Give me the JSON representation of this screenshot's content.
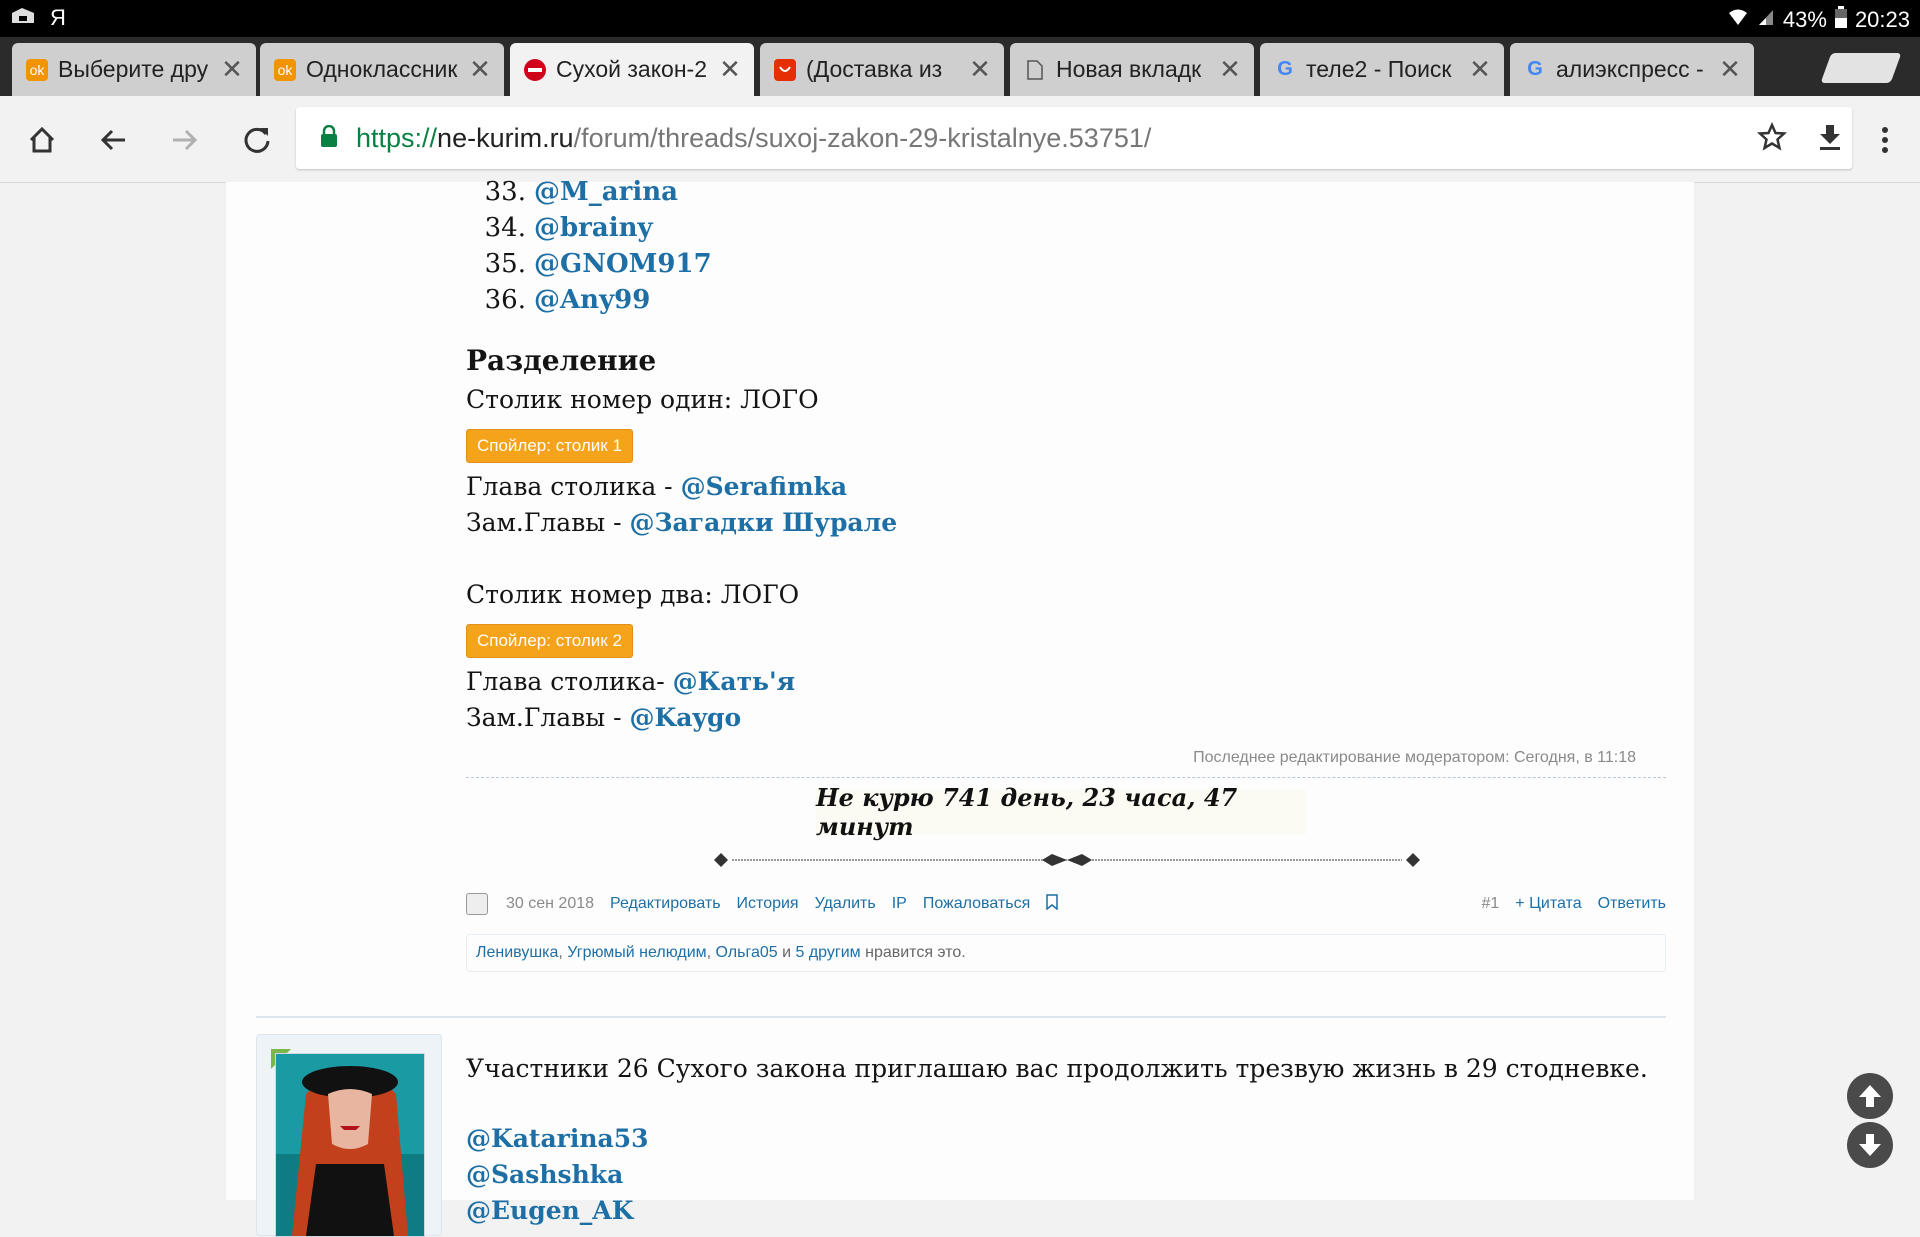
{
  "statusbar": {
    "left_icon_1": "briefcase-icon",
    "left_text": "Я",
    "battery": "43%",
    "time": "20:23"
  },
  "tabs": [
    {
      "title": "Выберите дру",
      "favicon": "ok-icon",
      "color": "#f29300"
    },
    {
      "title": "Одноклассник",
      "favicon": "ok-icon",
      "color": "#f29300"
    },
    {
      "title": "Сухой закон-2",
      "favicon": "no-entry-icon",
      "color": "#d0021b"
    },
    {
      "title": "(Доставка из",
      "favicon": "aliexpress-icon",
      "color": "#e62e04"
    },
    {
      "title": "Новая вкладк",
      "favicon": "page-icon",
      "color": "#777777"
    },
    {
      "title": "теле2 - Поиск",
      "favicon": "google-icon",
      "color": "#4285f4"
    },
    {
      "title": "алиэкспресс -",
      "favicon": "google-icon",
      "color": "#4285f4"
    }
  ],
  "tab_close_glyph": "✕",
  "toolbar": {
    "url_scheme": "https://",
    "url_host": "ne-kurim.ru",
    "url_path": "/forum/threads/suxoj-zakon-29-kristalnye.53751/"
  },
  "post1": {
    "members": [
      {
        "num": "33.",
        "name": "@M_arina"
      },
      {
        "num": "34.",
        "name": "@brainy"
      },
      {
        "num": "35.",
        "name": "@GNOM917"
      },
      {
        "num": "36.",
        "name": "@Any99"
      }
    ],
    "heading": "Разделение",
    "table1_text": "Столик номер один: ЛОГО",
    "spoiler1": "Спойлер: столик 1",
    "table1_head_prefix": "Глава столика - ",
    "table1_head_name": "@Serafimka",
    "table1_deputy_prefix": "Зам.Главы - ",
    "table1_deputy_name": "@Загадки Шурале",
    "table2_text": "Столик номер два: ЛОГО",
    "spoiler2": "Спойлер: столик 2",
    "table2_head_prefix": "Глава столика- ",
    "table2_head_name": "@Кать'я",
    "table2_deputy_prefix": "Зам.Главы - ",
    "table2_deputy_name": "@Kaygo",
    "edit_note": "Последнее редактирование модератором: Сегодня, в 11:18",
    "signature": "Не курю 741 день, 23 часа, 47 минут",
    "date": "30 сен 2018",
    "actions": [
      "Редактировать",
      "История",
      "Удалить",
      "IP",
      "Пожаловаться"
    ],
    "post_number": "#1",
    "quote": "+ Цитата",
    "reply": "Ответить",
    "likes_users": [
      "Ленивушка",
      "Угрюмый нелюдим",
      "Ольга05"
    ],
    "likes_sep": ", ",
    "likes_and": " и ",
    "likes_others": "5 другим",
    "likes_suffix": " нравится это."
  },
  "post2": {
    "text": "Участники 26 Сухого закона приглашаю вас продолжить трезвую жизнь в 29 стодневке.",
    "mentions": [
      "@Katarina53",
      "@Sashshka",
      "@Eugen_AK"
    ]
  }
}
